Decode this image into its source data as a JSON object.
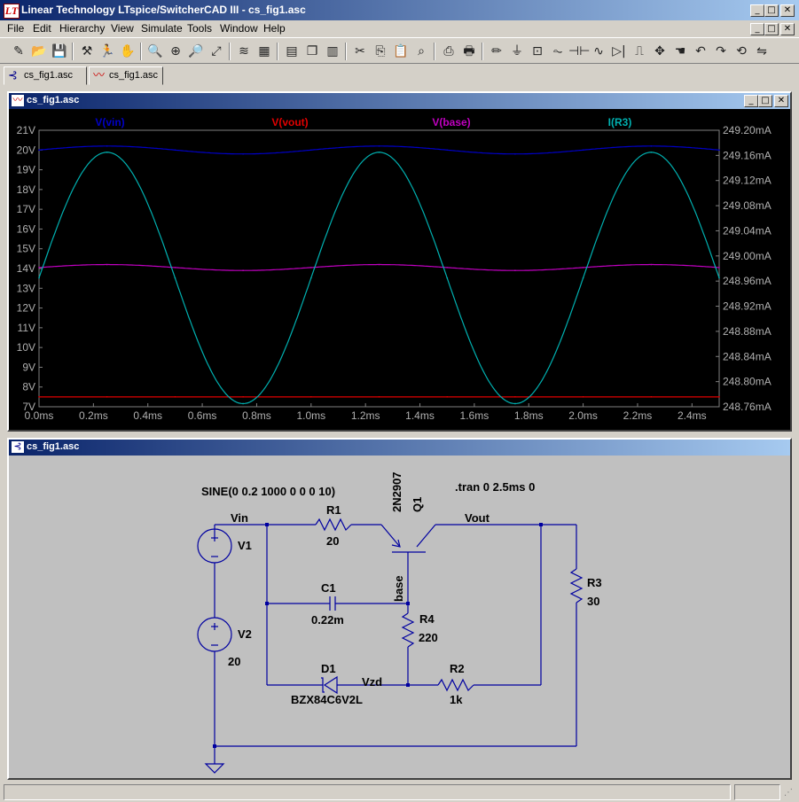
{
  "app": {
    "title": "Linear Technology LTspice/SwitcherCAD III - cs_fig1.asc",
    "icon": "ltspice-logo-icon",
    "icon_glyph": "LT",
    "window_buttons": {
      "minimize": "_",
      "maximize": "□",
      "close": "✕"
    }
  },
  "menu": [
    "File",
    "Edit",
    "Hierarchy",
    "View",
    "Simulate",
    "Tools",
    "Window",
    "Help"
  ],
  "toolbar": {
    "buttons": [
      {
        "icon": "new-schematic-icon",
        "glyph": "✎"
      },
      {
        "icon": "open-file-icon",
        "glyph": "📂"
      },
      {
        "icon": "save-icon",
        "glyph": "💾"
      },
      {
        "icon": "control-panel-icon",
        "glyph": "⚒"
      },
      {
        "icon": "run-icon",
        "glyph": "🏃"
      },
      {
        "icon": "halt-icon",
        "glyph": "✋"
      },
      {
        "icon": "zoom-in-icon",
        "glyph": "🔍"
      },
      {
        "icon": "pan-icon",
        "glyph": "⊕"
      },
      {
        "icon": "zoom-out-icon",
        "glyph": "🔎"
      },
      {
        "icon": "zoom-fit-icon",
        "glyph": "⤢"
      },
      {
        "icon": "autorange-icon",
        "glyph": "≋"
      },
      {
        "icon": "plot-settings-icon",
        "glyph": "▦"
      },
      {
        "icon": "tile-horizontal-icon",
        "glyph": "▤"
      },
      {
        "icon": "cascade-icon",
        "glyph": "❐"
      },
      {
        "icon": "tile-vertical-icon",
        "glyph": "▥"
      },
      {
        "icon": "cut-icon",
        "glyph": "✂"
      },
      {
        "icon": "copy-icon",
        "glyph": "⎘"
      },
      {
        "icon": "paste-icon",
        "glyph": "📋"
      },
      {
        "icon": "find-icon",
        "glyph": "⌕"
      },
      {
        "icon": "print-setup-icon",
        "glyph": "⎙"
      },
      {
        "icon": "print-icon",
        "glyph": "🖶"
      },
      {
        "icon": "draw-wire-icon",
        "glyph": "✏"
      },
      {
        "icon": "ground-icon",
        "glyph": "⏚"
      },
      {
        "icon": "label-net-icon",
        "glyph": "⊡"
      },
      {
        "icon": "resistor-icon",
        "glyph": "⏦"
      },
      {
        "icon": "capacitor-icon",
        "glyph": "⊣⊢"
      },
      {
        "icon": "inductor-icon",
        "glyph": "∿"
      },
      {
        "icon": "diode-icon",
        "glyph": "▷|"
      },
      {
        "icon": "component-icon",
        "glyph": "⎍"
      },
      {
        "icon": "move-icon",
        "glyph": "✥"
      },
      {
        "icon": "drag-icon",
        "glyph": "☚"
      },
      {
        "icon": "undo-icon",
        "glyph": "↶"
      },
      {
        "icon": "redo-icon",
        "glyph": "↷"
      },
      {
        "icon": "rotate-icon",
        "glyph": "⟲"
      },
      {
        "icon": "mirror-icon",
        "glyph": "⇋"
      }
    ]
  },
  "tabs": [
    {
      "label": "cs_fig1.asc",
      "icon": "schematic-icon",
      "glyph": "⊰"
    },
    {
      "label": "cs_fig1.asc",
      "icon": "waveform-icon",
      "glyph": "〰"
    }
  ],
  "plot_window": {
    "title": "cs_fig1.asc",
    "icon": "waveform-icon",
    "icon_glyph": "〰"
  },
  "schematic_window": {
    "title": "cs_fig1.asc",
    "icon": "schematic-icon",
    "icon_glyph": "⊰",
    "labels": {
      "source_spec": "SINE(0 0.2 1000 0 0 0 10)",
      "tran": ".tran 0 2.5ms 0",
      "vin": "Vin",
      "vout": "Vout",
      "base": "base",
      "vzd": "Vzd",
      "v1": "V1",
      "v2": "V2",
      "v2_value": "20",
      "r1": "R1",
      "r1_value": "20",
      "r2": "R2",
      "r2_value": "1k",
      "r3": "R3",
      "r3_value": "30",
      "r4": "R4",
      "r4_value": "220",
      "c1": "C1",
      "c1_value": "0.22m",
      "d1": "D1",
      "d1_model": "BZX84C6V2L",
      "q1": "Q1",
      "q1_model": "2N2907"
    }
  },
  "colors": {
    "vin": "#0000c8",
    "vout": "#e00000",
    "base": "#c000c0",
    "ir3": "#00b0b0",
    "wire": "#0000a0",
    "plot_bg": "#000000",
    "schematic_bg": "#c0c0c0",
    "axis_text": "#b0b0b0"
  },
  "chart_data": {
    "type": "line",
    "title": "",
    "xlabel": "",
    "ylabel": "",
    "x_ticks": [
      "0.0ms",
      "0.2ms",
      "0.4ms",
      "0.6ms",
      "0.8ms",
      "1.0ms",
      "1.2ms",
      "1.4ms",
      "1.6ms",
      "1.8ms",
      "2.0ms",
      "2.2ms",
      "2.4ms"
    ],
    "y_left_ticks": [
      "21V",
      "20V",
      "19V",
      "18V",
      "17V",
      "16V",
      "15V",
      "14V",
      "13V",
      "12V",
      "11V",
      "10V",
      "9V",
      "8V",
      "7V"
    ],
    "y_right_ticks": [
      "249.20mA",
      "249.16mA",
      "249.12mA",
      "249.08mA",
      "249.04mA",
      "249.00mA",
      "248.96mA",
      "248.92mA",
      "248.88mA",
      "248.84mA",
      "248.80mA",
      "248.76mA"
    ],
    "xlim_ms": [
      0,
      2.5
    ],
    "ylim_left_V": [
      7,
      21
    ],
    "ylim_right_mA": [
      248.76,
      249.2
    ],
    "grid": false,
    "legend": "top",
    "series": [
      {
        "name": "V(vin)",
        "axis": "left",
        "x_ms": [
          0,
          0.25,
          0.5,
          0.75,
          1.0,
          1.25,
          1.5,
          1.75,
          2.0,
          2.25,
          2.5
        ],
        "y": [
          20,
          20.2,
          20,
          19.8,
          20,
          20.2,
          20,
          19.8,
          20,
          20.2,
          20
        ]
      },
      {
        "name": "V(vout)",
        "axis": "left",
        "x_ms": [
          0,
          0.25,
          0.5,
          0.75,
          1.0,
          1.25,
          1.5,
          1.75,
          2.0,
          2.25,
          2.5
        ],
        "y": [
          7.5,
          7.5,
          7.5,
          7.5,
          7.5,
          7.5,
          7.5,
          7.5,
          7.5,
          7.5,
          7.5
        ]
      },
      {
        "name": "V(base)",
        "axis": "left",
        "x_ms": [
          0,
          0.25,
          0.5,
          0.75,
          1.0,
          1.25,
          1.5,
          1.75,
          2.0,
          2.25,
          2.5
        ],
        "y": [
          14.05,
          14.2,
          14.05,
          13.9,
          14.05,
          14.2,
          14.05,
          13.9,
          14.05,
          14.2,
          14.05
        ]
      },
      {
        "name": "I(R3)",
        "axis": "right",
        "x_ms": [
          0,
          0.25,
          0.5,
          0.75,
          1.0,
          1.25,
          1.5,
          1.75,
          2.0,
          2.25,
          2.5
        ],
        "y": [
          248.965,
          249.165,
          248.965,
          248.765,
          248.965,
          249.165,
          248.965,
          248.765,
          248.965,
          249.165,
          248.965
        ]
      }
    ]
  }
}
